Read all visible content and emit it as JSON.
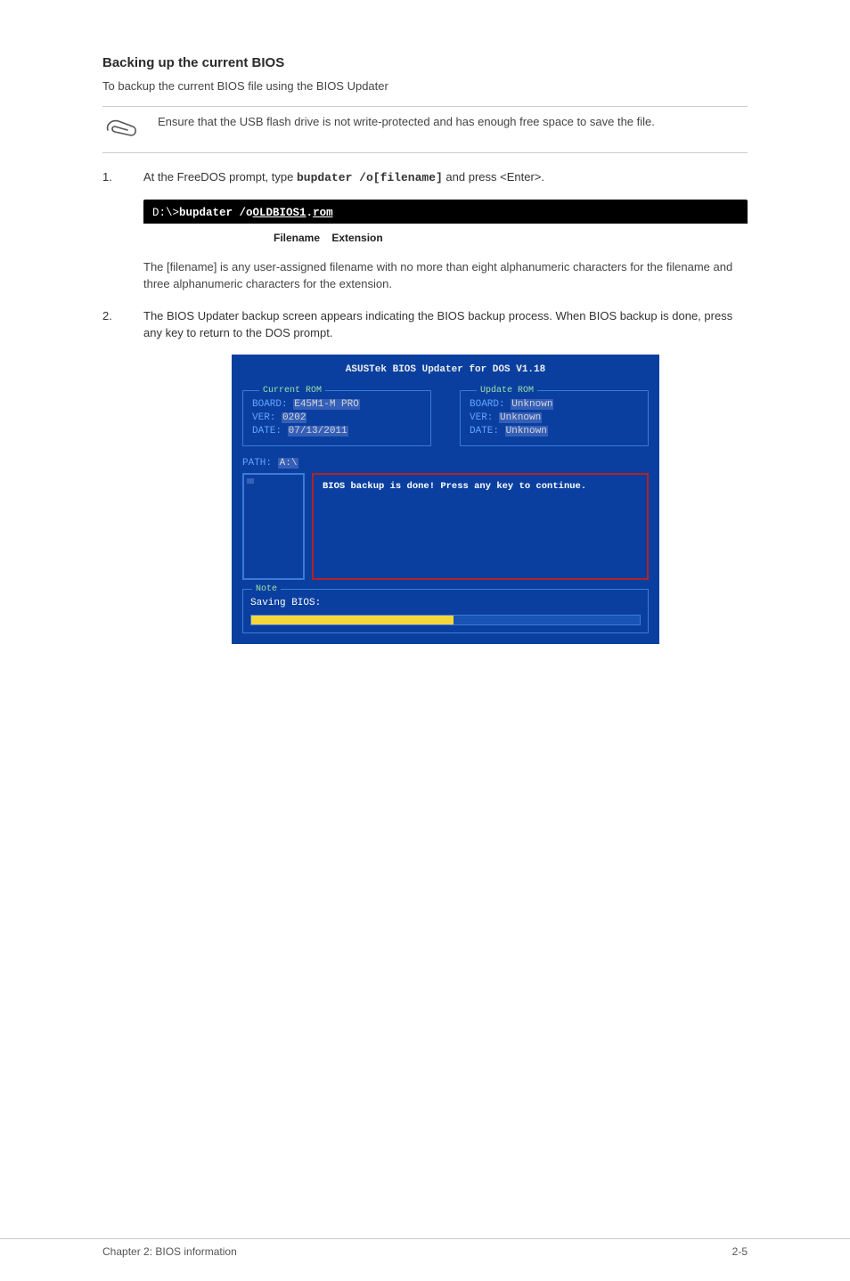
{
  "heading": "Backing up the current BIOS",
  "intro": "To backup the current BIOS file using the BIOS Updater",
  "note": "Ensure that the USB flash drive is not write-protected and has enough free space to save the file.",
  "steps": {
    "s1": {
      "num": "1.",
      "pre": "At the FreeDOS prompt, type ",
      "cmd_inline": "bupdater /o[filename]",
      "post": " and press <Enter>.",
      "cmd_block": {
        "prompt": "D:\\>",
        "cmd": "bupdater /o",
        "file": "OLDBIOS1",
        "dot": ".",
        "ext": "rom"
      },
      "labels": {
        "filename": "Filename",
        "extension": "Extension"
      },
      "filename_note": "The [filename] is any user-assigned filename with no more than eight alphanumeric characters for the filename and three alphanumeric characters for the extension."
    },
    "s2": {
      "num": "2.",
      "text": "The BIOS Updater backup screen appears indicating the BIOS backup process. When BIOS backup is done, press any key to return to the DOS prompt."
    }
  },
  "bios": {
    "title": "ASUSTek BIOS Updater for DOS V1.18",
    "current": {
      "legend": "Current ROM",
      "board_label": "BOARD:",
      "board_val": "E45M1-M PRO",
      "ver_label": "VER:",
      "ver_val": "0202",
      "date_label": "DATE:",
      "date_val": "07/13/2011"
    },
    "update": {
      "legend": "Update ROM",
      "board_label": "BOARD:",
      "board_val": "Unknown",
      "ver_label": "VER:",
      "ver_val": "Unknown",
      "date_label": "DATE:",
      "date_val": "Unknown"
    },
    "path_label": "PATH:",
    "path_val": "A:\\",
    "done_msg": "BIOS backup is done! Press any key to continue.",
    "note_legend": "Note",
    "saving": "Saving BIOS:"
  },
  "footer": {
    "left": "Chapter 2: BIOS information",
    "right": "2-5"
  }
}
